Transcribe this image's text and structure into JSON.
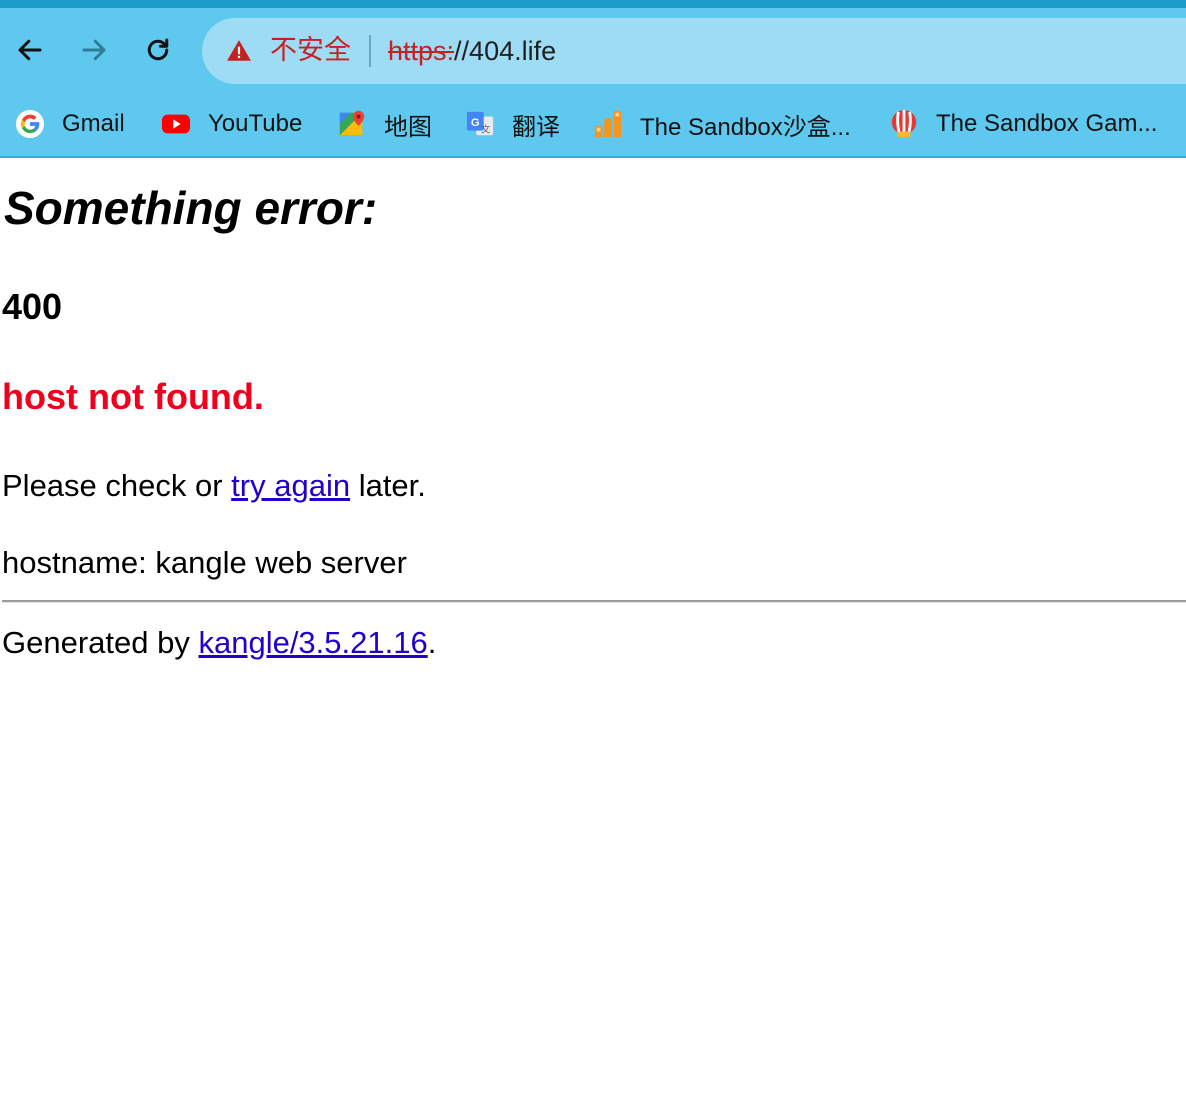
{
  "browser": {
    "omnibox": {
      "security_label": "不安全",
      "url_scheme": "https:",
      "url_rest": "//404.life"
    },
    "bookmarks": [
      {
        "label": "Gmail",
        "icon": "google-icon"
      },
      {
        "label": "YouTube",
        "icon": "youtube-icon"
      },
      {
        "label": "地图",
        "icon": "maps-icon"
      },
      {
        "label": "翻译",
        "icon": "translate-icon"
      },
      {
        "label": "The Sandbox沙盒...",
        "icon": "sandbox-icon"
      },
      {
        "label": "The Sandbox Gam...",
        "icon": "balloon-icon"
      }
    ],
    "colors": {
      "toolbar": "#5ec8ee",
      "omnibox": "#9edcf5",
      "insecure": "#c5221f"
    }
  },
  "page": {
    "title": "Something error:",
    "code": "400",
    "message": "host not found.",
    "hint_prefix": "Please check or ",
    "hint_link": "try again",
    "hint_suffix": " later.",
    "hostname": "hostname: kangle web server",
    "footer_prefix": "Generated by ",
    "footer_link": "kangle/3.5.21.16",
    "footer_suffix": ".",
    "colors": {
      "message": "#f0001c",
      "link": "#2200cc"
    }
  }
}
